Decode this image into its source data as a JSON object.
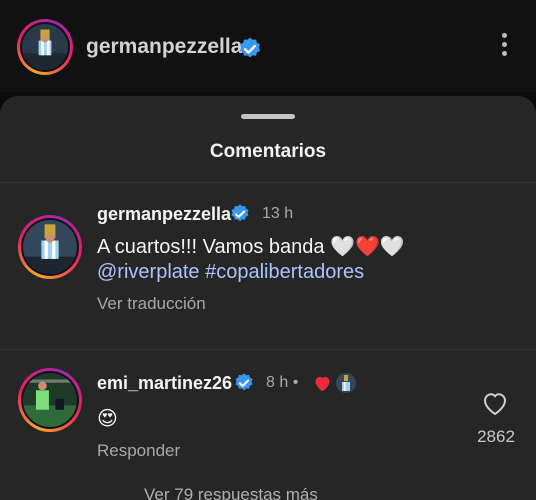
{
  "post": {
    "username": "germanpezzella",
    "avatar": "trophy-player-photo",
    "menu_icon": "more-vertical-icon"
  },
  "sheet": {
    "title": "Comentarios"
  },
  "comments": [
    {
      "username": "germanpezzella",
      "verified": true,
      "time": "13 h",
      "text": "A cuartos!!! Vamos banda ",
      "emojis": "🤍❤️🤍",
      "mentions": "@riverplate #copalibertadores",
      "translate": "Ver traducción"
    },
    {
      "username": "emi_martinez26",
      "verified": true,
      "time": "8 h •",
      "liked_by_author_icon": "red-heart-icon",
      "text_emoji": "😍",
      "reply": "Responder",
      "likes": "2862",
      "view_replies": "Ver 79 respuestas más"
    }
  ],
  "colors": {
    "background": "#0b0b0b",
    "sheet": "#262626",
    "verified": "#3897f0",
    "link": "#a9c4ff",
    "muted": "#a8a8a8"
  }
}
